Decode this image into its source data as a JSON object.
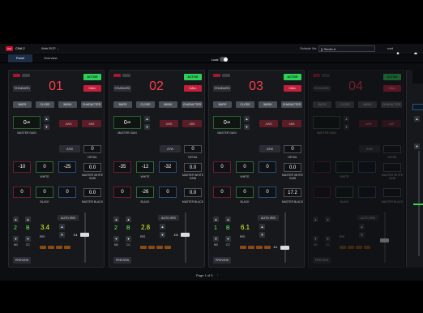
{
  "app": {
    "logo_text": "CNA",
    "title": "CNA 2",
    "menu_label": "Web RCP",
    "menu_caret": "⌄"
  },
  "header": {
    "studio_label": "Outside Vis",
    "studio_value": "[] Studio A",
    "user_name": "root"
  },
  "tabs": {
    "panel": "Panel",
    "overview": "Overview"
  },
  "lock_label": "Lock",
  "footer": {
    "page": "Page 1 of 3",
    "next_glyph": "›"
  },
  "panels": [
    {
      "num": "01",
      "standard": "STANDARD",
      "active": "ACTIVE",
      "call": "CALL",
      "buttons": [
        "BARS",
        "CLOSE",
        "5600K",
        "CHARACTER"
      ],
      "gain": "0",
      "gain_unit": "dB",
      "master_gain": "MASTER GAIN",
      "awb": "AWB",
      "abb": "ABB",
      "atw": "ATW",
      "detail_val": "0",
      "detail": "DETAIL",
      "white": [
        "-10",
        "0",
        "-25"
      ],
      "white_label": "WHITE",
      "master_white": "0.0",
      "master_white_label": "MASTER WHITE GAIN",
      "black": [
        "0",
        "0",
        "0"
      ],
      "black_label": "BLACK",
      "master_black": "0.0",
      "master_black_label": "MASTER BLACK",
      "nd": "2",
      "cc": "B",
      "iris": "3.4",
      "auto_iris": "AUTO IRIS",
      "iris_small": "3.4",
      "iris_level": 0.55,
      "preview": "PREVIEW"
    },
    {
      "num": "02",
      "standard": "STANDARD",
      "active": "ACTIVE",
      "call": "CALL",
      "buttons": [
        "BARS",
        "CLOSE",
        "5600K",
        "CHARACTER"
      ],
      "gain": "0",
      "gain_unit": "dB",
      "master_gain": "MASTER GAIN",
      "awb": "AWB",
      "abb": "ABB",
      "atw": "ATW",
      "detail_val": "0",
      "detail": "DETAIL",
      "white": [
        "-35",
        "-12",
        "-32"
      ],
      "white_label": "WHITE",
      "master_white": "0.0",
      "master_white_label": "MASTER WHITE GAIN",
      "black": [
        "0",
        "-26",
        "0"
      ],
      "black_label": "BLACK",
      "master_black": "0.0",
      "master_black_label": "MASTER BLACK",
      "nd": "2",
      "cc": "B",
      "iris": "2.8",
      "auto_iris": "AUTO IRIS",
      "iris_small": "2.8",
      "iris_level": 0.55,
      "preview": "PREVIEW"
    },
    {
      "num": "03",
      "standard": "STANDARD",
      "active": "ACTIVE",
      "call": "CALL",
      "buttons": [
        "BARS",
        "CLOSE",
        "5600K",
        "CHARACTER"
      ],
      "gain": "0",
      "gain_unit": "dB",
      "master_gain": "MASTER GAIN",
      "awb": "AWB",
      "abb": "ABB",
      "atw": "ATW",
      "detail_val": "0",
      "detail": "DETAIL",
      "white": [
        "0",
        "0",
        "0"
      ],
      "white_label": "WHITE",
      "master_white": "0.0",
      "master_white_label": "MASTER WHITE GAIN",
      "black": [
        "0",
        "0",
        "0"
      ],
      "black_label": "BLACK",
      "master_black": "17.2",
      "master_black_label": "MASTER BLACK",
      "nd": "1",
      "cc": "B",
      "iris": "6.1",
      "auto_iris": "AUTO IRIS",
      "iris_small": "6.1",
      "iris_level": 0.3,
      "preview": "PREVIEW"
    },
    {
      "num": "04",
      "standard": "STANDARD",
      "active": "ACTIVE",
      "call": "CALL",
      "buttons": [
        "BARS",
        "CLOSE",
        "5600K",
        "CHARACTER"
      ],
      "gain": "",
      "gain_unit": "",
      "master_gain": "MASTER GAIN",
      "awb": "AWB",
      "abb": "ABB",
      "atw": "ATW",
      "detail_val": "",
      "detail": "DETAIL",
      "white": [
        "",
        "",
        ""
      ],
      "white_label": "WHITE",
      "master_white": "",
      "master_white_label": "MASTER WHITE GAIN",
      "black": [
        "",
        "",
        ""
      ],
      "black_label": "BLACK",
      "master_black": "",
      "master_black_label": "MASTER BLACK",
      "nd": "",
      "cc": "",
      "iris": "",
      "auto_iris": "AUTO IRIS",
      "iris_small": "",
      "iris_level": 0.45,
      "preview": "PREVIEW"
    }
  ]
}
